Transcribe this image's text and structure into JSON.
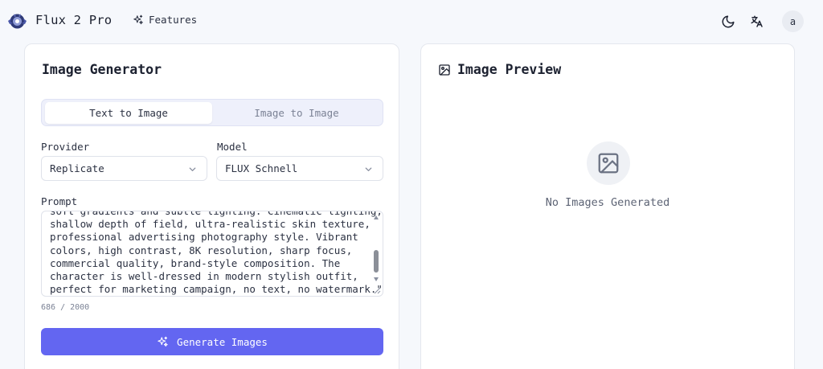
{
  "header": {
    "brand": "Flux 2 Pro",
    "nav_features": "Features",
    "avatar_letter": "a"
  },
  "generator": {
    "title": "Image Generator",
    "tabs": [
      {
        "label": "Text to Image",
        "active": true
      },
      {
        "label": "Image to Image",
        "active": false
      }
    ],
    "provider_label": "Provider",
    "provider_value": "Replicate",
    "model_label": "Model",
    "model_value": "FLUX Schnell",
    "prompt_label": "Prompt",
    "prompt_text": "soft gradients and subtle lighting. Cinematic lighting,\nshallow depth of field, ultra-realistic skin texture,\nprofessional advertising photography style. Vibrant\ncolors, high contrast, 8K resolution, sharp focus,\ncommercial quality, brand-style composition. The\ncharacter is well-dressed in modern stylish outfit,\nperfect for marketing campaign, no text, no watermark.\"",
    "char_count": "686 / 2000",
    "generate_label": "Generate Images"
  },
  "preview": {
    "title": "Image Preview",
    "empty_message": "No Images Generated"
  },
  "colors": {
    "accent": "#6366f1",
    "background": "#f6f8fc",
    "tab_bg": "#eef0fb"
  },
  "icons": {
    "logo": "logo-icon",
    "features": "sparkles-icon",
    "theme": "moon-icon",
    "language": "translate-icon",
    "preview": "image-icon",
    "select": "chevron-down-icon"
  }
}
